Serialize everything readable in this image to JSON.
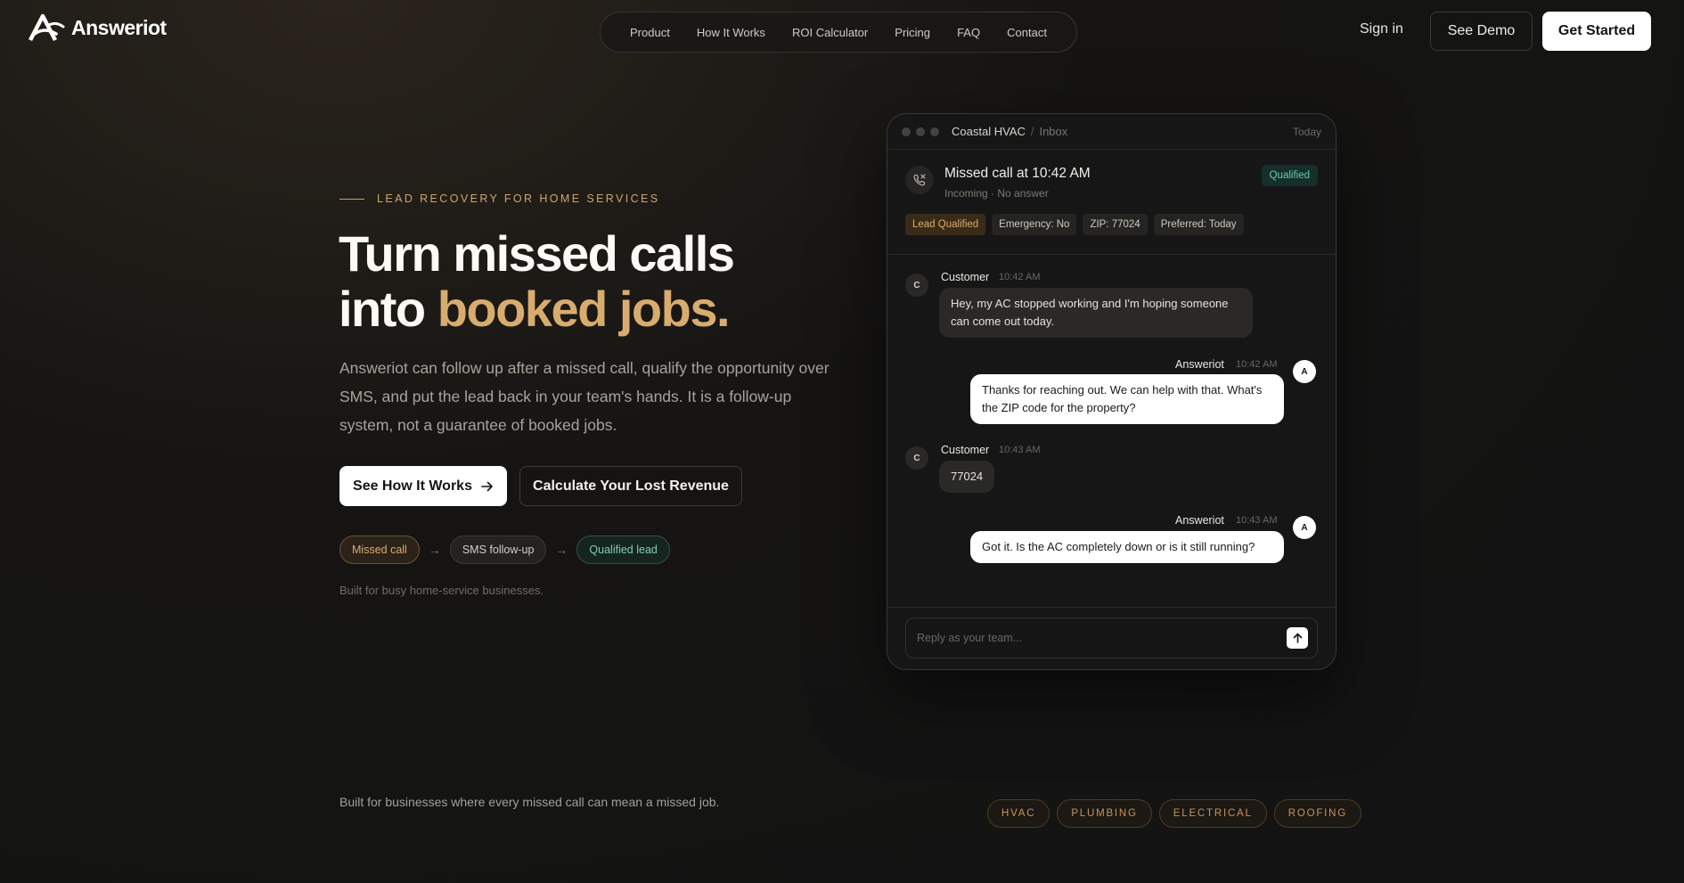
{
  "brand": {
    "name": "Answeriot",
    "logo_icon": "answeriot-logo-icon"
  },
  "nav": {
    "items": [
      "Product",
      "How It Works",
      "ROI Calculator",
      "Pricing",
      "FAQ",
      "Contact"
    ]
  },
  "header": {
    "signin": "Sign in",
    "demo": "See Demo",
    "start": "Get Started"
  },
  "hero": {
    "eyebrow": "LEAD RECOVERY FOR HOME SERVICES",
    "headline_line1": "Turn missed calls",
    "headline_line2_prefix": "into ",
    "headline_line2_accent": "booked jobs.",
    "lede": "Answeriot can follow up after a missed call, qualify the opportunity over SMS, and put the lead back in your team's hands. It is a follow-up system, not a guarantee of booked jobs.",
    "cta_primary": "See How It Works",
    "cta_secondary": "Calculate Your Lost Revenue",
    "flow": [
      "Missed call",
      "SMS follow-up",
      "Qualified lead"
    ],
    "flow_arrow": "→",
    "built_for": "Built for busy home-service businesses."
  },
  "inbox": {
    "org": "Coastal HVAC",
    "separator": "/",
    "section": "Inbox",
    "date": "Today",
    "call": {
      "title": "Missed call at 10:42 AM",
      "meta": "Incoming · No answer",
      "status": "Qualified",
      "tags": [
        "Lead Qualified",
        "Emergency: No",
        "ZIP: 77024",
        "Preferred: Today"
      ]
    },
    "messages": [
      {
        "sender": "Customer",
        "initial": "C",
        "time": "10:42 AM",
        "text": "Hey, my AC stopped working and I'm hoping someone can come out today."
      },
      {
        "sender": "Answeriot",
        "initial": "A",
        "time": "10:42 AM",
        "text": "Thanks for reaching out. We can help with that. What's the ZIP code for the property?"
      },
      {
        "sender": "Customer",
        "initial": "C",
        "time": "10:43 AM",
        "text": "77024"
      },
      {
        "sender": "Answeriot",
        "initial": "A",
        "time": "10:43 AM",
        "text": "Got it. Is the AC completely down or is it still running?"
      }
    ],
    "reply_placeholder": "Reply as your team..."
  },
  "footer": {
    "strap": "Built for businesses where every missed call can mean a missed job.",
    "industries": [
      "HVAC",
      "PLUMBING",
      "ELECTRICAL",
      "ROOFING"
    ]
  },
  "colors": {
    "accent_gold": "#d8ac6f",
    "qualified_green": "#6cc9a6",
    "background": "#141414"
  }
}
